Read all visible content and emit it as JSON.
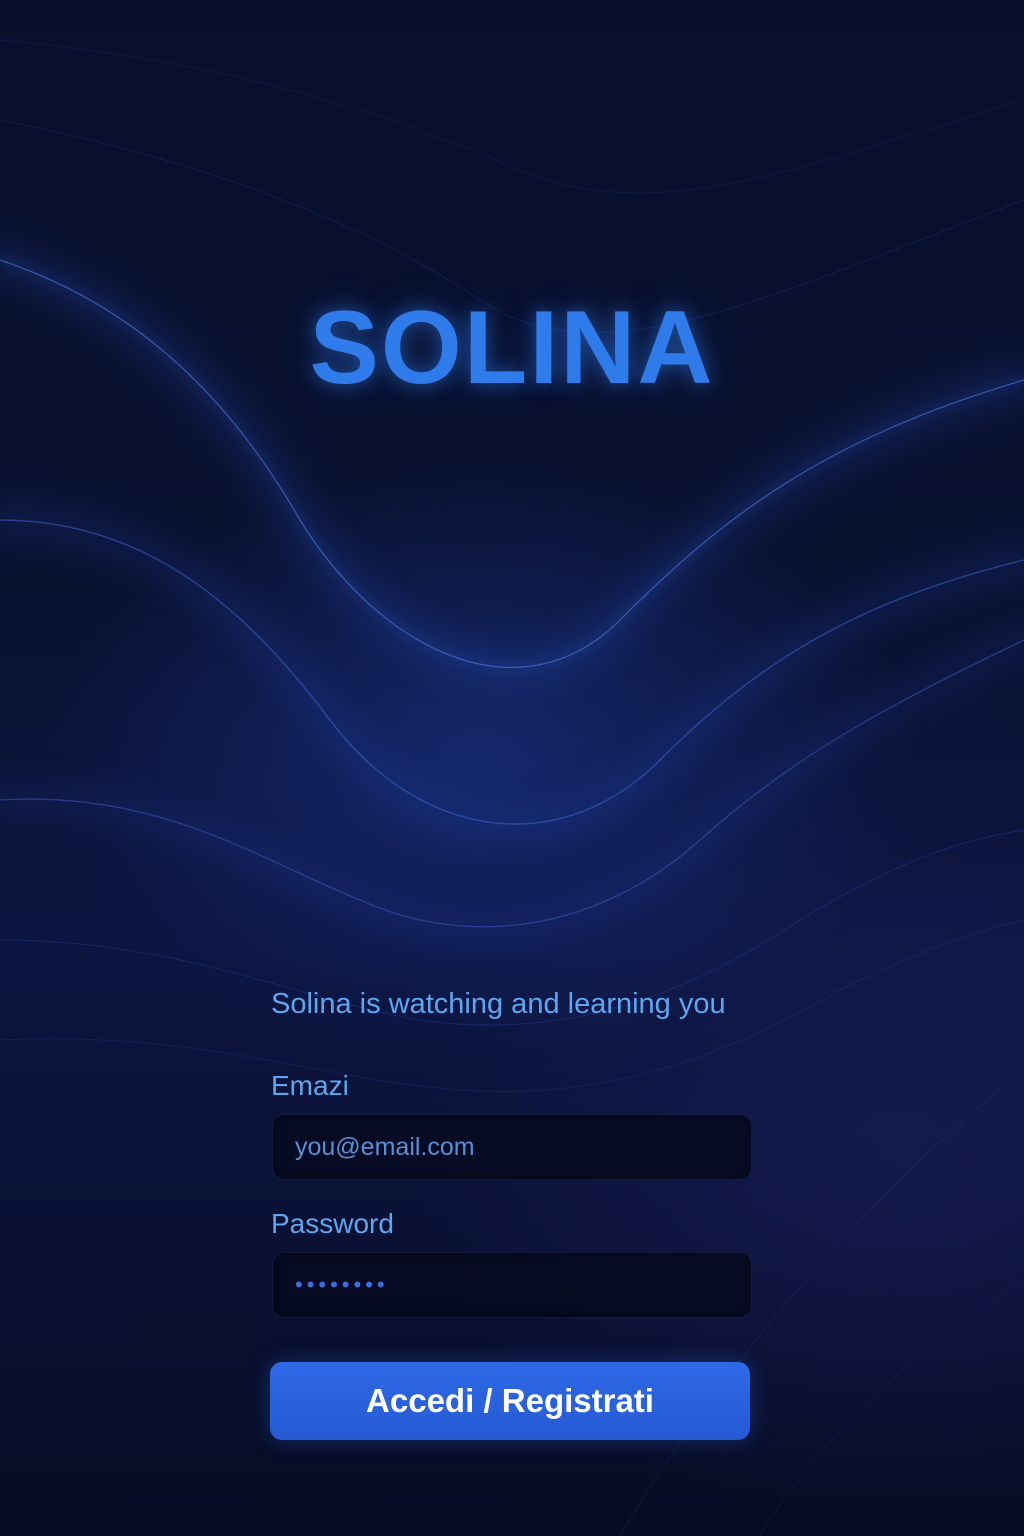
{
  "app": {
    "logo_text": "SOLINA",
    "tagline": "Solina is watching and learning you"
  },
  "form": {
    "email_label": "Emazi",
    "email_placeholder": "you@email.com",
    "password_label": "Password",
    "password_value": "••••••••",
    "submit_label": "Accedi / Registrati"
  },
  "colors": {
    "background": "#0a1233",
    "accent": "#2f7bea",
    "label_text": "#5ea6f0",
    "button": "#2a62df",
    "button_text": "#ffffff"
  }
}
